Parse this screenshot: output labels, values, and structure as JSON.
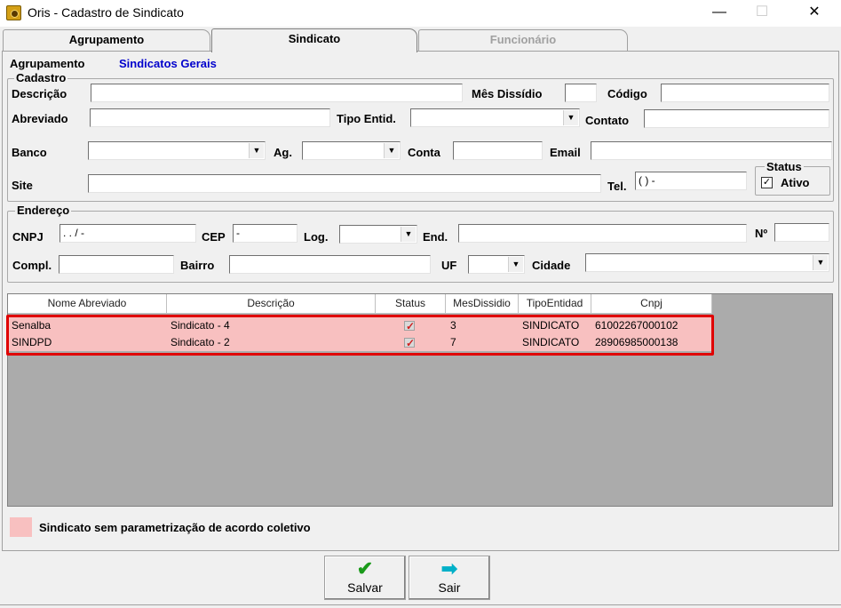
{
  "window": {
    "title": "Oris - Cadastro de Sindicato",
    "minimize": "—",
    "maximize": "☐",
    "close": "✕"
  },
  "tabs": [
    {
      "label": "Agrupamento"
    },
    {
      "label": "Sindicato"
    },
    {
      "label": "Funcionário"
    }
  ],
  "agrupamento": {
    "label": "Agrupamento",
    "value": "Sindicatos Gerais"
  },
  "cadastro": {
    "legend": "Cadastro",
    "descricao": {
      "label": "Descrição",
      "value": ""
    },
    "mes_dissidio": {
      "label": "Mês Dissídio",
      "value": ""
    },
    "codigo": {
      "label": "Código",
      "value": ""
    },
    "abreviado": {
      "label": "Abreviado",
      "value": ""
    },
    "tipo_entid": {
      "label": "Tipo Entid.",
      "value": ""
    },
    "contato": {
      "label": "Contato",
      "value": ""
    },
    "banco": {
      "label": "Banco",
      "value": ""
    },
    "ag": {
      "label": "Ag.",
      "value": ""
    },
    "conta": {
      "label": "Conta",
      "value": ""
    },
    "email": {
      "label": "Email",
      "value": ""
    },
    "site": {
      "label": "Site",
      "value": ""
    },
    "tel": {
      "label": "Tel.",
      "value": "(  )    -"
    },
    "status": {
      "legend": "Status",
      "ativo_label": "Ativo",
      "ativo_checked": true
    }
  },
  "endereco": {
    "legend": "Endereço",
    "cnpj": {
      "label": "CNPJ",
      "value": "  .    .    /    -"
    },
    "cep": {
      "label": "CEP",
      "value": "     -"
    },
    "log": {
      "label": "Log.",
      "value": ""
    },
    "end": {
      "label": "End.",
      "value": ""
    },
    "numero": {
      "label": "Nº",
      "value": ""
    },
    "compl": {
      "label": "Compl.",
      "value": ""
    },
    "bairro": {
      "label": "Bairro",
      "value": ""
    },
    "uf": {
      "label": "UF",
      "value": ""
    },
    "cidade": {
      "label": "Cidade",
      "value": ""
    }
  },
  "grid": {
    "columns": [
      "Nome Abreviado",
      "Descrição",
      "Status",
      "MesDissidio",
      "TipoEntidad",
      "Cnpj"
    ],
    "rows": [
      {
        "nome": "Senalba",
        "descricao": "Sindicato - 4",
        "status": "checked",
        "mes": "3",
        "tipo": "SINDICATO",
        "cnpj": "61002267000102"
      },
      {
        "nome": "SINDPD",
        "descricao": "Sindicato - 2",
        "status": "checked",
        "mes": "7",
        "tipo": "SINDICATO",
        "cnpj": "28906985000138"
      }
    ]
  },
  "legend_note": {
    "text": "Sindicato sem parametrização de acordo coletivo",
    "color": "#f8c0c0"
  },
  "buttons": {
    "salvar": {
      "label": "Salvar",
      "icon": "green-check-icon"
    },
    "sair": {
      "label": "Sair",
      "icon": "cyan-arrow-right-icon"
    }
  },
  "colors": {
    "highlight_border": "#e00000",
    "row_highlight": "#f8c0c0",
    "agrupamento_value": "#0000cc"
  }
}
